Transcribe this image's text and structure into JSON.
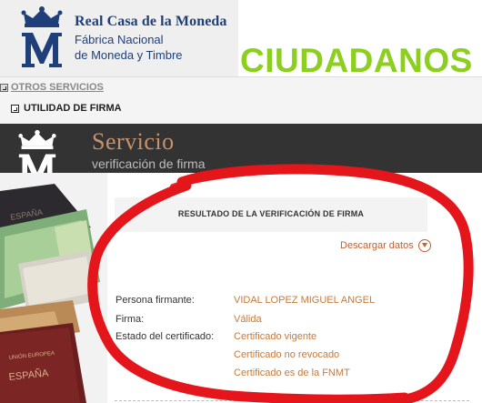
{
  "header": {
    "logo_name": "Real Casa de la Moneda",
    "logo_sub1": "Fábrica Nacional",
    "logo_sub2": "de Moneda y Timbre",
    "section": "CIUDADANOS"
  },
  "menu": {
    "otros": "OTROS SERVICIOS",
    "utilidad": "UTILIDAD DE FIRMA"
  },
  "banner": {
    "title": "Servicio",
    "subtitle": "verificación de firma"
  },
  "result": {
    "title": "RESULTADO DE LA VERIFICACIÓN DE FIRMA",
    "download": "Descargar datos",
    "rows": [
      {
        "label": "Persona firmante:",
        "value": "VIDAL LOPEZ MIGUEL ANGEL"
      },
      {
        "label": "Firma:",
        "value": "Válida"
      },
      {
        "label": "Estado del certificado:",
        "value": "Certificado vigente"
      }
    ],
    "extra_values": [
      "Certificado no revocado",
      "Certificado es de la FNMT"
    ]
  },
  "colors": {
    "brand_blue": "#1f3f7a",
    "section_green": "#8ccf1e",
    "accent_orange": "#c57a3c",
    "annotation_red": "#e4161b"
  }
}
